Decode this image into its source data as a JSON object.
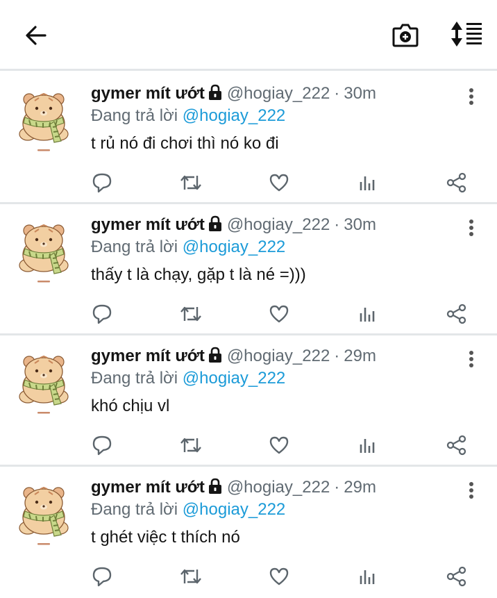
{
  "icons": {
    "back": "arrow-left-icon",
    "camera": "camera-plus-icon",
    "sort": "sort-list-icon",
    "lock": "lock-icon",
    "more": "more-vertical-icon",
    "reply": "reply-icon",
    "retweet": "retweet-icon",
    "like": "heart-icon",
    "stats": "stats-icon",
    "share": "share-icon"
  },
  "colors": {
    "accent": "#1c9bd8",
    "muted": "#616b73",
    "divider": "#e3e6e8"
  },
  "tweets": [
    {
      "name": "gymer mít ướt",
      "handle": "@hogiay_222",
      "sep": "·",
      "time": "30m",
      "reply_prefix": "Đang trả lời",
      "reply_to": "@hogiay_222",
      "text": "t rủ nó đi chơi thì nó ko đi"
    },
    {
      "name": "gymer mít ướt",
      "handle": "@hogiay_222",
      "sep": "·",
      "time": "30m",
      "reply_prefix": "Đang trả lời",
      "reply_to": "@hogiay_222",
      "text": "thấy t là chạy, gặp t là né =)))"
    },
    {
      "name": "gymer mít ướt",
      "handle": "@hogiay_222",
      "sep": "·",
      "time": "29m",
      "reply_prefix": "Đang trả lời",
      "reply_to": "@hogiay_222",
      "text": "khó chịu vl"
    },
    {
      "name": "gymer mít ướt",
      "handle": "@hogiay_222",
      "sep": "·",
      "time": "29m",
      "reply_prefix": "Đang trả lời",
      "reply_to": "@hogiay_222",
      "text": "t ghét việc t thích nó"
    }
  ]
}
